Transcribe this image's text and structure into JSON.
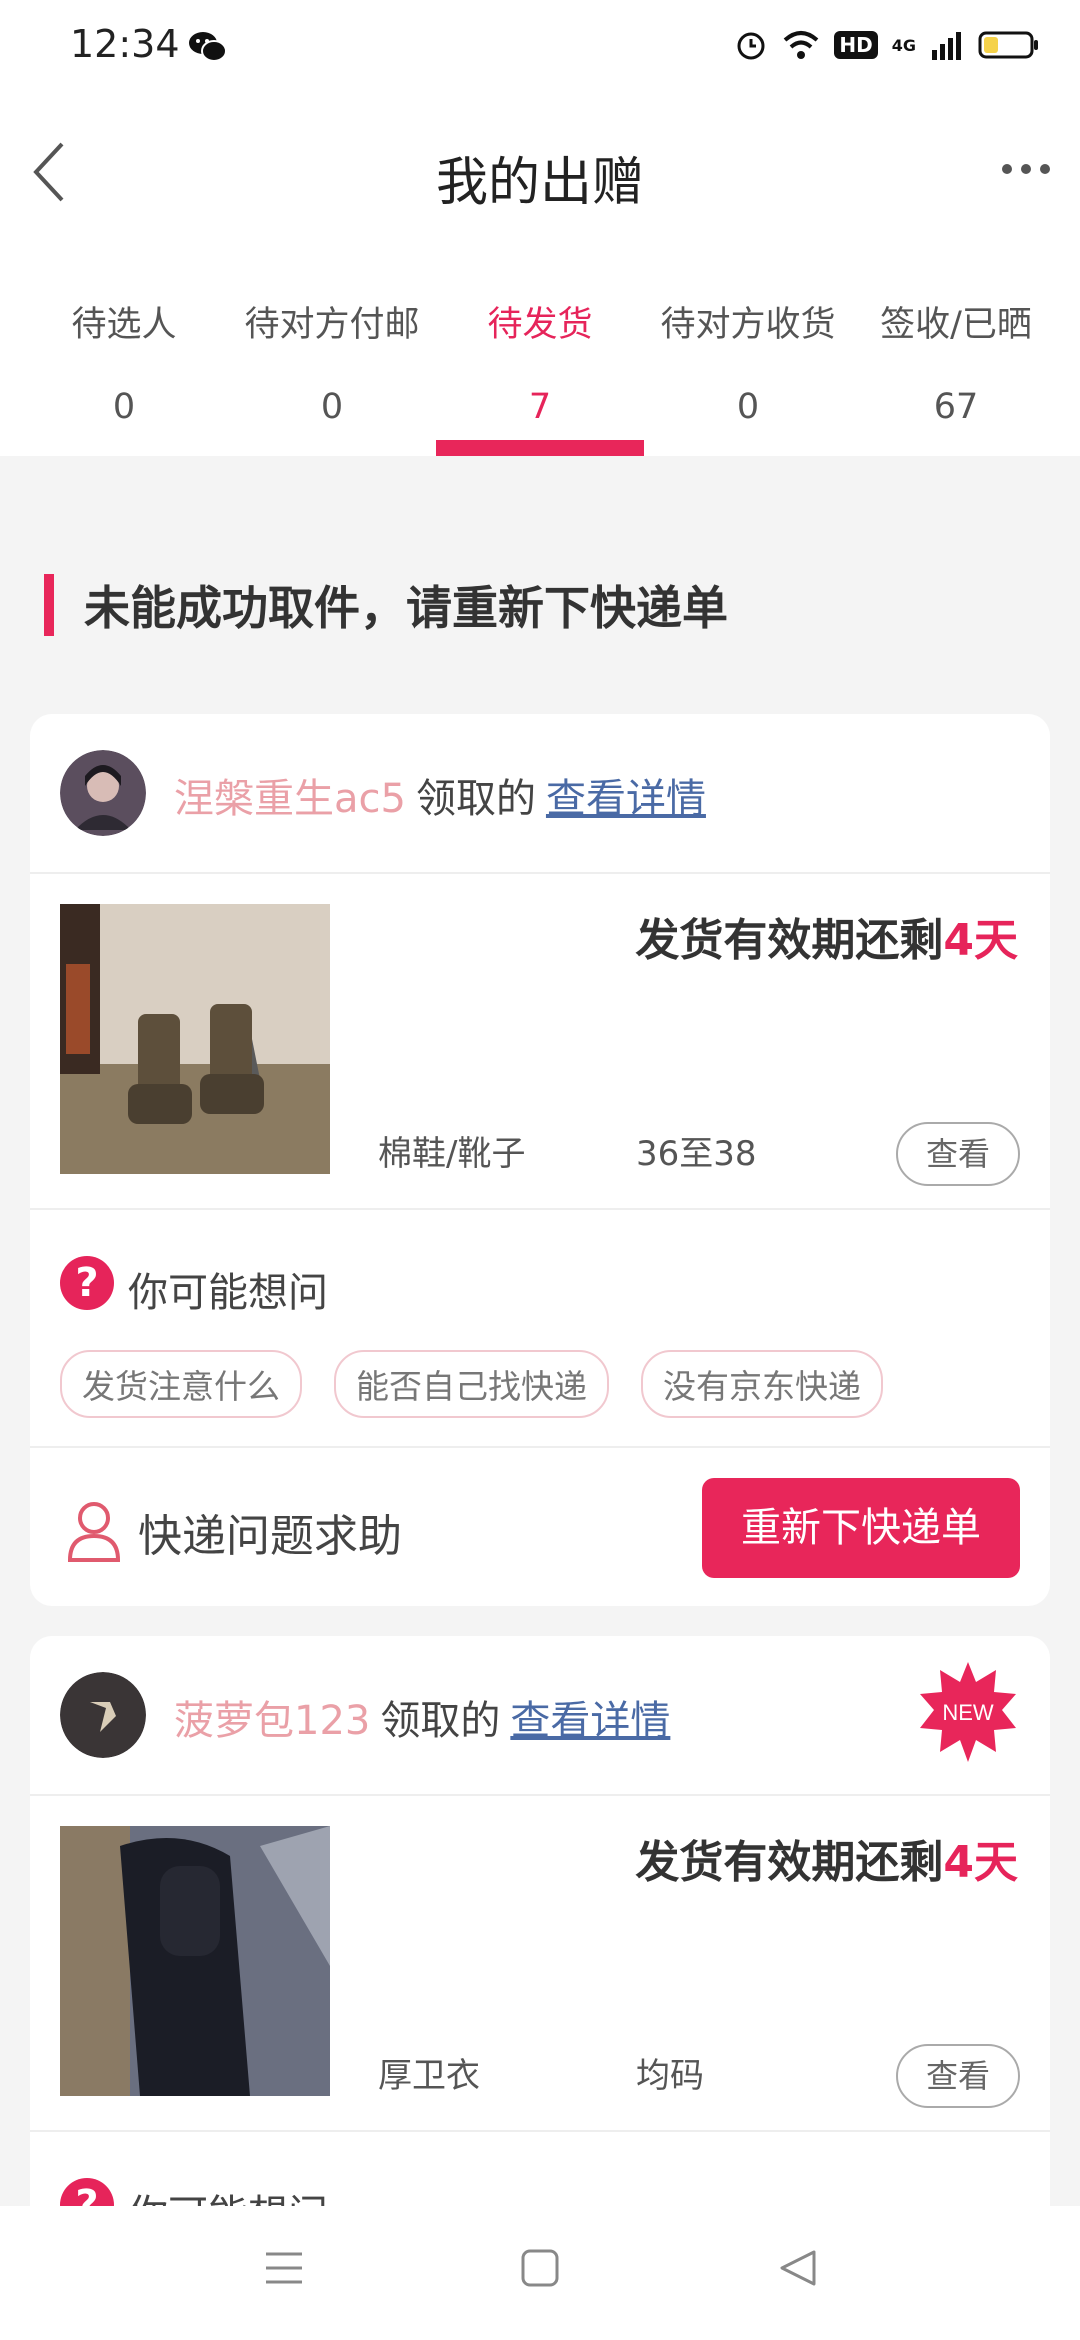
{
  "status_bar": {
    "time": "12:34",
    "network": "4G"
  },
  "header": {
    "title": "我的出赠"
  },
  "tabs": [
    {
      "label": "待选人",
      "count": "0"
    },
    {
      "label": "待对方付邮",
      "count": "0"
    },
    {
      "label": "待发货",
      "count": "7"
    },
    {
      "label": "待对方收货",
      "count": "0"
    },
    {
      "label": "签收/已晒",
      "count": "67"
    }
  ],
  "active_tab": "待发货",
  "section": {
    "title": "未能成功取件，请重新下快递单"
  },
  "cards": [
    {
      "user_name": "涅槃重生ac5",
      "claim_text": "领取的",
      "detail_link": "查看详情",
      "deadline_prefix": "发货有效期还剩",
      "deadline_days": "4天",
      "category": "棉鞋/靴子",
      "size": "36至38",
      "view_label": "查看",
      "faq_title": "你可能想问",
      "faq_chips": [
        "发货注意什么",
        "能否自己找快递",
        "没有京东快递"
      ],
      "help_label": "快递问题求助",
      "action_label": "重新下快递单"
    },
    {
      "user_name": "菠萝包123",
      "claim_text": "领取的",
      "detail_link": "查看详情",
      "badge": "NEW",
      "deadline_prefix": "发货有效期还剩",
      "deadline_days": "4天",
      "category": "厚卫衣",
      "size": "均码",
      "view_label": "查看",
      "faq_title": "你可能想问"
    }
  ],
  "colors": {
    "accent": "#e8265a",
    "username": "#eaa0a7",
    "link": "#4a6aa5"
  }
}
